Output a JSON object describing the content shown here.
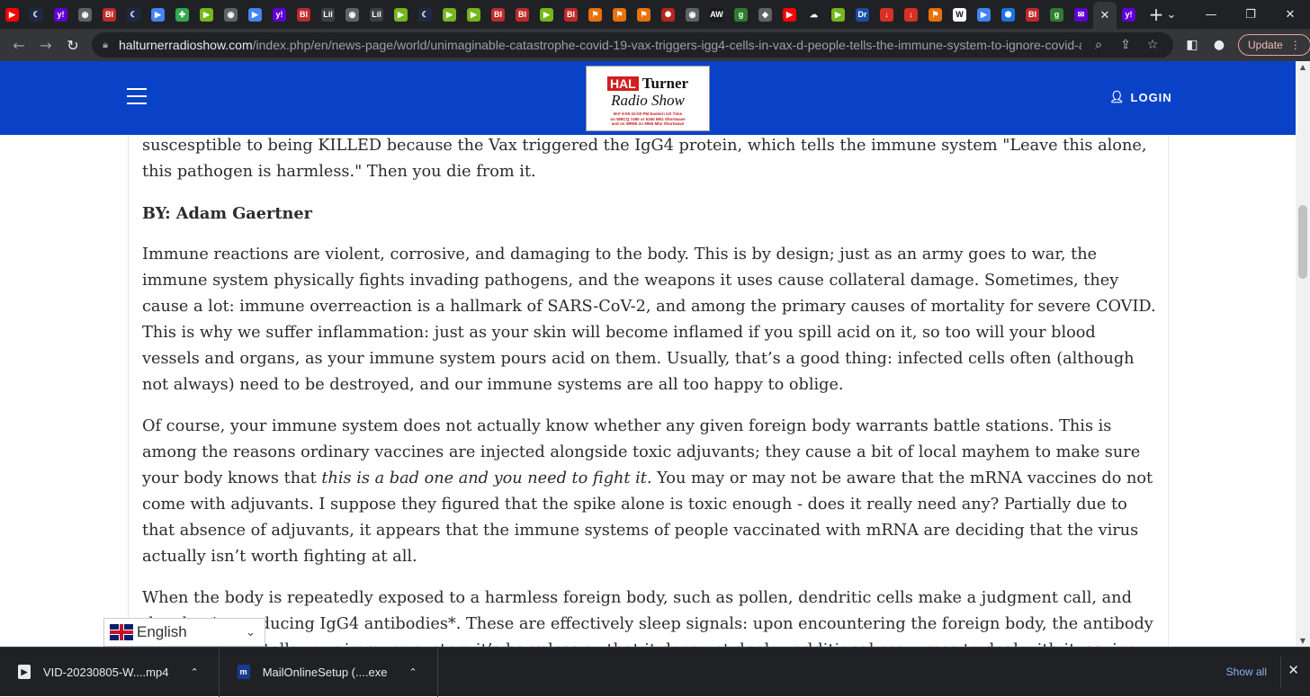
{
  "tabs": [
    {
      "icon": "youtube-icon",
      "color": "#ff0000",
      "glyph": "▶"
    },
    {
      "icon": "crescent-icon",
      "color": "#1e2a44",
      "glyph": "☾"
    },
    {
      "icon": "yahoo-icon",
      "color": "#6001d2",
      "glyph": "y!"
    },
    {
      "icon": "globe-icon",
      "color": "#5f6368",
      "glyph": "◉"
    },
    {
      "icon": "business-insider-icon",
      "color": "#c02a2a",
      "glyph": "BI"
    },
    {
      "icon": "crescent-icon",
      "color": "#1e2a44",
      "glyph": "☾"
    },
    {
      "icon": "flag-icon",
      "color": "#4285f4",
      "glyph": "▶"
    },
    {
      "icon": "map-icon",
      "color": "#34a853",
      "glyph": "✚"
    },
    {
      "icon": "rumble-icon",
      "color": "#74b71b",
      "glyph": "▶"
    },
    {
      "icon": "globe-icon",
      "color": "#5f6368",
      "glyph": "◉"
    },
    {
      "icon": "flag-icon",
      "color": "#4285f4",
      "glyph": "▶"
    },
    {
      "icon": "yahoo-icon",
      "color": "#6001d2",
      "glyph": "y!"
    },
    {
      "icon": "business-insider-icon",
      "color": "#c02a2a",
      "glyph": "BI"
    },
    {
      "icon": "lil-icon",
      "color": "#3c4043",
      "glyph": "Lil"
    },
    {
      "icon": "globe-icon",
      "color": "#5f6368",
      "glyph": "◉"
    },
    {
      "icon": "lil-icon",
      "color": "#3c4043",
      "glyph": "Lil"
    },
    {
      "icon": "rumble-icon",
      "color": "#74b71b",
      "glyph": "▶"
    },
    {
      "icon": "crescent-icon",
      "color": "#1e2a44",
      "glyph": "☾"
    },
    {
      "icon": "rumble-icon",
      "color": "#74b71b",
      "glyph": "▶"
    },
    {
      "icon": "rumble-icon",
      "color": "#74b71b",
      "glyph": "▶"
    },
    {
      "icon": "business-insider-icon",
      "color": "#c02a2a",
      "glyph": "BI"
    },
    {
      "icon": "business-insider-icon",
      "color": "#c02a2a",
      "glyph": "BI"
    },
    {
      "icon": "rumble-icon",
      "color": "#74b71b",
      "glyph": "▶"
    },
    {
      "icon": "business-insider-icon",
      "color": "#c02a2a",
      "glyph": "BI"
    },
    {
      "icon": "bookmark-icon",
      "color": "#e8710a",
      "glyph": "⚑"
    },
    {
      "icon": "bookmark-icon",
      "color": "#e8710a",
      "glyph": "⚑"
    },
    {
      "icon": "bookmark-icon",
      "color": "#e8710a",
      "glyph": "⚑"
    },
    {
      "icon": "burst-icon",
      "color": "#b3261e",
      "glyph": "✺"
    },
    {
      "icon": "globe-icon",
      "color": "#5f6368",
      "glyph": "◉"
    },
    {
      "icon": "news-icon",
      "color": "#1a1a1a",
      "glyph": "AW"
    },
    {
      "icon": "g-icon",
      "color": "#2e7d32",
      "glyph": "g"
    },
    {
      "icon": "shield-icon",
      "color": "#5f6368",
      "glyph": "◆"
    },
    {
      "icon": "youtube-icon",
      "color": "#ff0000",
      "glyph": "▶"
    },
    {
      "icon": "cloud-icon",
      "color": "#202124",
      "glyph": "☁"
    },
    {
      "icon": "rumble-icon",
      "color": "#74b71b",
      "glyph": "▶"
    },
    {
      "icon": "drudge-icon",
      "color": "#174ea6",
      "glyph": "Dr"
    },
    {
      "icon": "download-icon",
      "color": "#d93025",
      "glyph": "↓"
    },
    {
      "icon": "download-icon",
      "color": "#d93025",
      "glyph": "↓"
    },
    {
      "icon": "bookmark-icon",
      "color": "#e8710a",
      "glyph": "⚑"
    },
    {
      "icon": "wsj-icon",
      "color": "#ffffff",
      "glyph": "W"
    },
    {
      "icon": "flag-icon",
      "color": "#4285f4",
      "glyph": "▶"
    },
    {
      "icon": "hex-icon",
      "color": "#1a73e8",
      "glyph": "⬢"
    },
    {
      "icon": "business-insider-icon",
      "color": "#c02a2a",
      "glyph": "BI"
    },
    {
      "icon": "g-icon",
      "color": "#2e7d32",
      "glyph": "g"
    },
    {
      "icon": "yahoo-mail-icon",
      "color": "#6001d2",
      "glyph": "✉"
    }
  ],
  "active_tab": {
    "icon": "yahoo-icon",
    "color": "#6001d2",
    "glyph": "y!"
  },
  "browser": {
    "url_domain": "halturnerradioshow.com",
    "url_path": "/index.php/en/news-page/world/unimaginable-catastrophe-covid-19-vax-triggers-igg4-cells-in-vax-d-people-tells-the-immune-system-to-ignore-covid-as-i...",
    "update_label": "Update"
  },
  "site": {
    "logo_hal": "HAL",
    "logo_turner": "Turner",
    "logo_radio": "Radio Show",
    "logo_line1": "M-F 9:00-10:00 PM Eastern US Time",
    "logo_line2": "on WBCQ 7490 or 5160 Mhz Shortwave",
    "logo_line3": "and on WRMI on 9955 Mhz Shortwave",
    "login_label": "LOGIN",
    "header_color": "#0a42c7"
  },
  "article": {
    "intro": "suscesptible to being KILLED because the Vax triggered the IgG4 protein, which tells the immune system \"Leave this alone, this pathogen is harmless.\"  Then you die from it.",
    "byline": "BY:  Adam Gaertner",
    "p1": "Immune reactions are violent, corrosive, and damaging to the body. This is by design; just as an army goes to war, the immune system physically fights invading pathogens, and the weapons it uses cause collateral damage. Sometimes, they cause a lot: immune overreaction is a hallmark of SARS-CoV-2, and among the primary causes of mortality for severe COVID. This is why we suffer inflammation: just as your skin will become inflamed if you spill acid on it, so too will your blood vessels and organs, as your immune system pours acid on them. Usually, that’s a good thing: infected cells often (although not always) need to be destroyed, and our immune systems are all too happy to oblige.",
    "p2_a": "Of course, your immune system does not actually know whether any given foreign body warrants battle stations. This is among the reasons ordinary vaccines are injected alongside toxic adjuvants; they cause a bit of local mayhem to make sure your body knows that ",
    "p2_em": "this is a bad one and you need to fight it.",
    "p2_b": " You may or may not be aware that the mRNA vaccines do not come with adjuvants. I suppose they figured that the spike alone is toxic enough - does it really need any? Partially due to that absence of adjuvants, it appears that the immune systems of people vaccinated with mRNA are deciding that the virus actually isn’t worth fighting at all.",
    "p3": "When the body is repeatedly exposed to a harmless foreign body, such as pollen, dendritic cells make a judgment call, and they begin producing IgG4 antibodies*. These are effectively sleep signals: upon encountering the foreign body, the antibody binds to it and tells your immune system it’s harmless so that it does not deploy additional resources to deal with it, saving the body"
  },
  "language": {
    "label": "English"
  },
  "downloads": {
    "items": [
      {
        "name": "VID-20230805-W....mp4"
      },
      {
        "name": "MailOnlineSetup (....exe"
      }
    ],
    "show_all": "Show all"
  }
}
